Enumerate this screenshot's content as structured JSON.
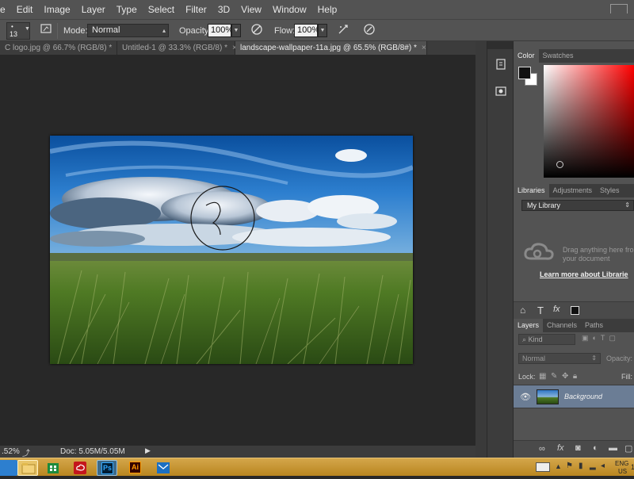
{
  "menubar": {
    "items": [
      "e",
      "Edit",
      "Image",
      "Layer",
      "Type",
      "Select",
      "Filter",
      "3D",
      "View",
      "Window",
      "Help"
    ]
  },
  "options": {
    "brush_size": "13",
    "mode_label": "Mode:",
    "mode_value": "Normal",
    "opacity_label": "Opacity:",
    "opacity_value": "100%",
    "flow_label": "Flow:",
    "flow_value": "100%"
  },
  "doc_tabs": [
    {
      "label": "C logo.jpg @ 66.7% (RGB/8) *",
      "active": false
    },
    {
      "label": "Untitled-1 @ 33.3% (RGB/8) *",
      "active": false
    },
    {
      "label": "landscape-wallpaper-11a.jpg @ 65.5% (RGB/8#) *",
      "active": true
    }
  ],
  "status": {
    "zoom": ".52%",
    "doc": "Doc: 5.05M/5.05M"
  },
  "color_panel": {
    "tabs": [
      "Color",
      "Swatches"
    ],
    "accent_red": "#ff0000"
  },
  "libraries_panel": {
    "tabs": [
      "Libraries",
      "Adjustments",
      "Styles"
    ],
    "library_select": "My Library",
    "drag_text": "Drag anything here fro your document",
    "learn_more": "Learn more about Librarie"
  },
  "layers_panel": {
    "tabs": [
      "Layers",
      "Channels",
      "Paths"
    ],
    "kind_select": "Kind",
    "blend_select": "Normal",
    "opacity_label": "Opacity:",
    "lock_label": "Lock:",
    "fill_label": "Fill:",
    "layer_name": "Background"
  },
  "taskbar": {
    "lang": "ENG",
    "region": "US",
    "time": "1:"
  }
}
